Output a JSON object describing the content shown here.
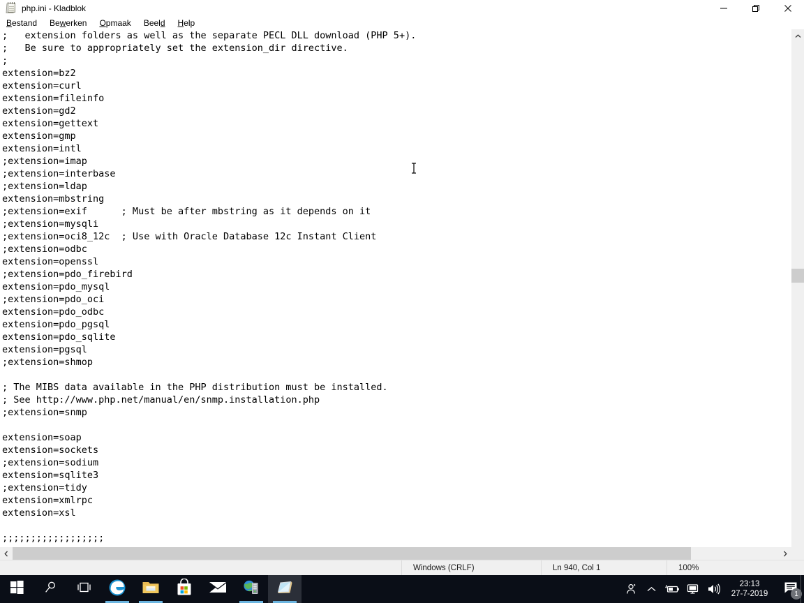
{
  "window": {
    "title": "php.ini - Kladblok",
    "icon": "notepad-icon",
    "buttons": {
      "minimize": "minimize-icon",
      "restore": "restore-icon",
      "close": "close-icon"
    }
  },
  "menubar": {
    "items": [
      {
        "label": "Bestand",
        "pre": "B",
        "accel": "",
        "post": "estand"
      },
      {
        "label": "Bewerken",
        "pre": "Be",
        "accel": "w",
        "post": "erken"
      },
      {
        "label": "Opmaak",
        "pre": "",
        "accel": "O",
        "post": "pmaak"
      },
      {
        "label": "Beeld",
        "pre": "Beel",
        "accel": "d",
        "post": ""
      },
      {
        "label": "Help",
        "pre": "",
        "accel": "H",
        "post": "elp"
      }
    ]
  },
  "editor": {
    "content": ";   extension folders as well as the separate PECL DLL download (PHP 5+).\n;   Be sure to appropriately set the extension_dir directive.\n;\nextension=bz2\nextension=curl\nextension=fileinfo\nextension=gd2\nextension=gettext\nextension=gmp\nextension=intl\n;extension=imap\n;extension=interbase\n;extension=ldap\nextension=mbstring\n;extension=exif      ; Must be after mbstring as it depends on it\n;extension=mysqli\n;extension=oci8_12c  ; Use with Oracle Database 12c Instant Client\n;extension=odbc\nextension=openssl\n;extension=pdo_firebird\nextension=pdo_mysql\n;extension=pdo_oci\nextension=pdo_odbc\nextension=pdo_pgsql\nextension=pdo_sqlite\nextension=pgsql\n;extension=shmop\n\n; The MIBS data available in the PHP distribution must be installed.\n; See http://www.php.net/manual/en/snmp.installation.php\n;extension=snmp\n\nextension=soap\nextension=sockets\n;extension=sodium\nextension=sqlite3\n;extension=tidy\nextension=xmlrpc\nextension=xsl\n\n;;;;;;;;;;;;;;;;;;\n"
  },
  "scrollbars": {
    "vertical": {
      "up": "chevron-up-icon",
      "down": "chevron-down-icon"
    },
    "horizontal": {
      "left": "chevron-left-icon",
      "right": "chevron-right-icon"
    }
  },
  "statusbar": {
    "spacer": "",
    "line_ending": "Windows (CRLF)",
    "position": "Ln 940, Col 1",
    "zoom": "100%"
  },
  "taskbar": {
    "items": [
      {
        "name": "start-button",
        "icon": "windows-logo-icon",
        "active": false,
        "open": false
      },
      {
        "name": "search-button",
        "icon": "search-icon",
        "active": false,
        "open": false
      },
      {
        "name": "task-view-button",
        "icon": "task-view-icon",
        "active": false,
        "open": false
      },
      {
        "name": "edge-button",
        "icon": "edge-icon",
        "active": false,
        "open": true
      },
      {
        "name": "file-explorer-button",
        "icon": "folder-icon",
        "active": false,
        "open": true
      },
      {
        "name": "microsoft-store-button",
        "icon": "store-icon",
        "active": false,
        "open": false
      },
      {
        "name": "mail-button",
        "icon": "mail-icon",
        "active": false,
        "open": false
      },
      {
        "name": "xampp-button",
        "icon": "server-globe-icon",
        "active": false,
        "open": true
      },
      {
        "name": "notepad-button",
        "icon": "notepad-icon",
        "active": true,
        "open": true
      }
    ],
    "tray": [
      {
        "name": "people-icon"
      },
      {
        "name": "show-hidden-icons-icon"
      },
      {
        "name": "battery-icon"
      },
      {
        "name": "network-icon"
      },
      {
        "name": "volume-icon"
      }
    ],
    "clock": {
      "time": "23:13",
      "date": "27-7-2019"
    },
    "action_center": {
      "icon": "action-center-icon",
      "badge": "1"
    }
  },
  "colors": {
    "taskbar_bg": "#0a0e17",
    "taskbar_active": "#2b2f38",
    "taskbar_underline": "#6bb5e0",
    "statusbar_bg": "#f0f0f0",
    "scroll_thumb": "#cdcdcd",
    "editor_bg": "#ffffff",
    "editor_fg": "#000000"
  }
}
